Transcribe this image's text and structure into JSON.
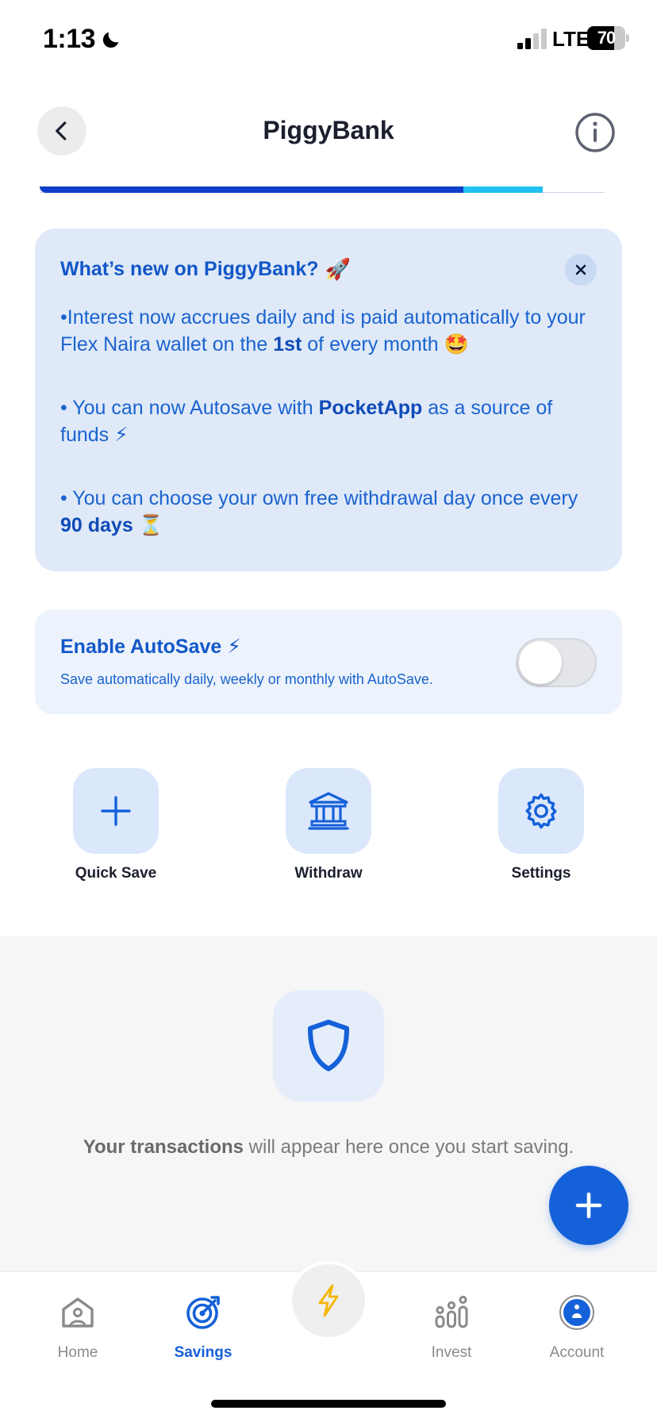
{
  "status_bar": {
    "time": "1:13",
    "network": "LTE",
    "battery": "70",
    "battery_level": 0.7
  },
  "header": {
    "title": "PiggyBank",
    "back_icon": "chevron-left-icon",
    "info_icon": "info-icon"
  },
  "progress": {
    "fill_fraction": 0.75,
    "buffer_fraction": 0.14
  },
  "news": {
    "title": "What’s new on PiggyBank?",
    "title_emoji": "🚀",
    "items": [
      {
        "prefix": "•Interest now accrues daily and is paid automatically to your Flex Naira wallet on the ",
        "bold": "1st",
        "suffix": " of every month 🤩"
      },
      {
        "prefix": "• You can now Autosave with ",
        "bold": "PocketApp",
        "suffix": " as a source of funds ⚡"
      },
      {
        "prefix": "• You can choose your own free withdrawal day once every ",
        "bold": "90 days",
        "suffix": " ⏳"
      }
    ]
  },
  "autosave": {
    "title": "Enable AutoSave",
    "title_emoji": "⚡",
    "subtitle": "Save automatically daily, weekly or monthly with AutoSave.",
    "enabled": false
  },
  "actions": [
    {
      "label": "Quick Save",
      "icon": "plus-icon"
    },
    {
      "label": "Withdraw",
      "icon": "bank-icon"
    },
    {
      "label": "Settings",
      "icon": "gear-icon"
    }
  ],
  "transactions": {
    "empty_bold": "Your transactions",
    "empty_rest": " will appear here once you start saving."
  },
  "bottom_nav": {
    "items": [
      {
        "label": "Home",
        "icon": "home-icon"
      },
      {
        "label": "Savings",
        "icon": "target-icon",
        "active": true
      },
      {
        "label": "Invest",
        "icon": "chart-icon"
      },
      {
        "label": "Account",
        "icon": "account-icon"
      }
    ],
    "center_icon": "lightning-icon"
  },
  "colors": {
    "primary": "#1461d9",
    "card_bg": "#dfe9f8",
    "accent_text": "#1257c8"
  }
}
